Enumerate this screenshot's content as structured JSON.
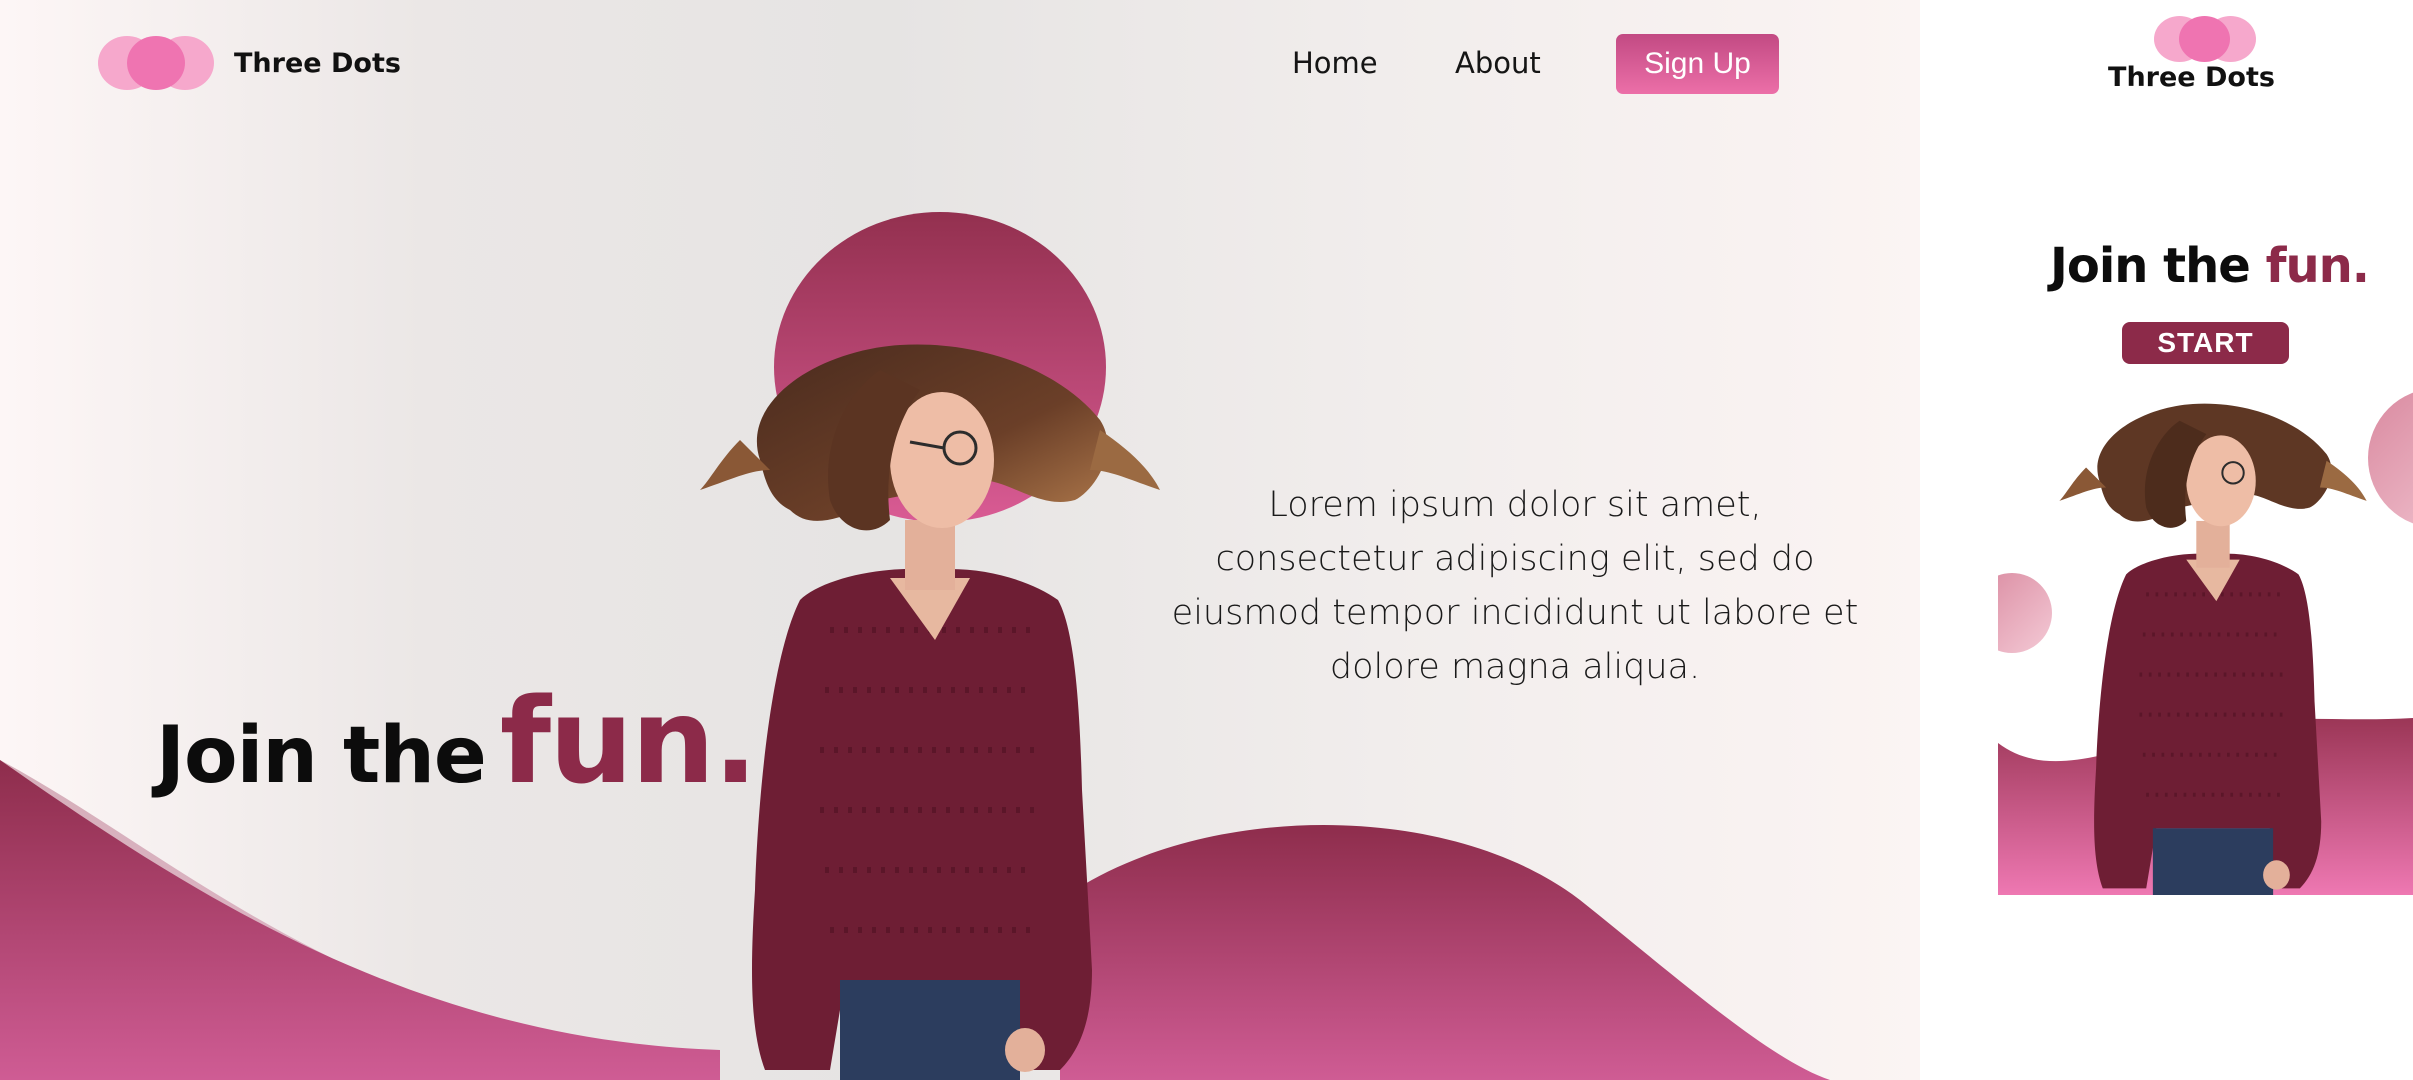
{
  "desktop": {
    "brand": {
      "name": "Three Dots"
    },
    "nav": {
      "home": "Home",
      "about": "About",
      "signup": "Sign Up"
    },
    "hero": {
      "title_prefix": "Join the",
      "title_accent": "fun.",
      "description": "Lorem ipsum dolor sit amet, consectetur adipiscing elit, sed do eiusmod tempor incididunt ut labore et dolore magna aliqua."
    }
  },
  "mobile": {
    "brand": {
      "name": "Three Dots"
    },
    "hero": {
      "title_prefix": "Join the",
      "title_accent": "fun.",
      "cta": "START"
    }
  },
  "colors": {
    "brand_pink": "#ef74b1",
    "light_pink": "#f6a8cc",
    "wine": "#8c2a49",
    "gradient_top": "#93304f",
    "gradient_bottom": "#d95b94"
  }
}
